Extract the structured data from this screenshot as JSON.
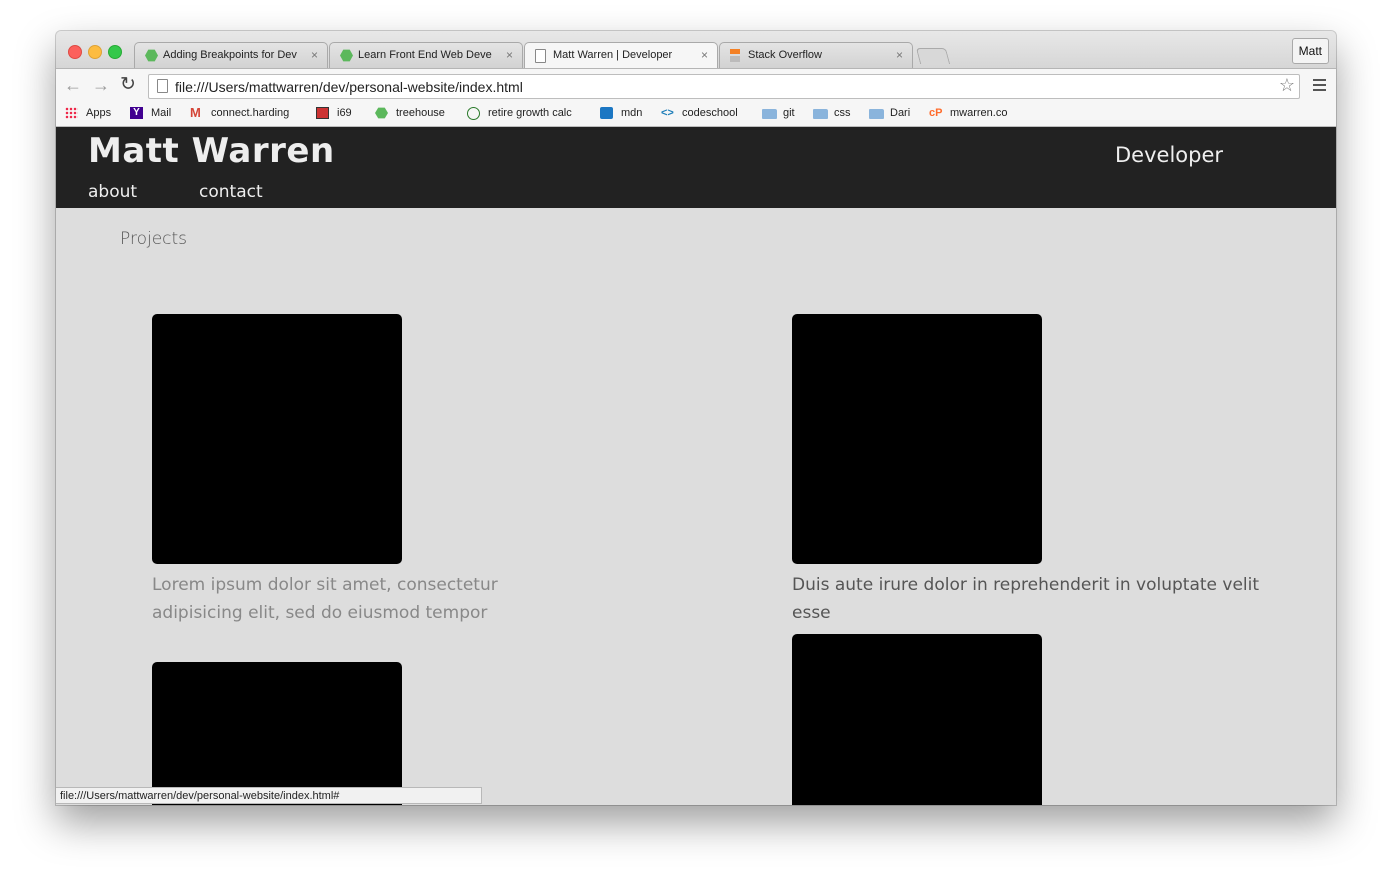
{
  "tabs": [
    {
      "label": "Adding Breakpoints for Dev",
      "icon": "treehouse-icon",
      "active": false
    },
    {
      "label": "Learn Front End Web Deve",
      "icon": "treehouse-icon",
      "active": false
    },
    {
      "label": "Matt Warren | Developer",
      "icon": "document-icon",
      "active": true
    },
    {
      "label": "Stack Overflow",
      "icon": "stackoverflow-icon",
      "active": false
    }
  ],
  "tab_close_glyph": "×",
  "profile": {
    "label": "Matt"
  },
  "omnibox": {
    "url": "file:///Users/mattwarren/dev/personal-website/index.html"
  },
  "bookmarks": [
    {
      "label": "Apps",
      "icon": "apps-grid-icon"
    },
    {
      "label": "Mail",
      "icon": "yahoo-icon"
    },
    {
      "label": "connect.harding",
      "icon": "gmail-icon"
    },
    {
      "label": "i69",
      "icon": "i69-icon"
    },
    {
      "label": "treehouse",
      "icon": "treehouse-icon"
    },
    {
      "label": "retire growth calc",
      "icon": "calculator-icon"
    },
    {
      "label": "mdn",
      "icon": "mdn-icon"
    },
    {
      "label": "codeschool",
      "icon": "code-brackets-icon"
    },
    {
      "label": "git",
      "icon": "folder-icon"
    },
    {
      "label": "css",
      "icon": "folder-icon"
    },
    {
      "label": "Dari",
      "icon": "folder-icon"
    },
    {
      "label": "mwarren.co",
      "icon": "cpanel-icon"
    }
  ],
  "site": {
    "title": "Matt Warren",
    "role": "Developer",
    "nav": {
      "about": "about",
      "contact": "contact"
    },
    "section_heading": "Projects",
    "projects": [
      {
        "description": "Lorem ipsum dolor sit amet, consectetur adipisicing elit, sed do eiusmod tempor"
      },
      {
        "description": "Duis aute irure dolor in reprehenderit in voluptate velit esse"
      },
      {
        "description": ""
      },
      {
        "description": ""
      }
    ]
  },
  "statusbar": {
    "text": "file:///Users/mattwarren/dev/personal-website/index.html#"
  },
  "colors": {
    "header_bg": "#222222",
    "page_bg": "#dddddd",
    "thumbnail": "#000000"
  }
}
